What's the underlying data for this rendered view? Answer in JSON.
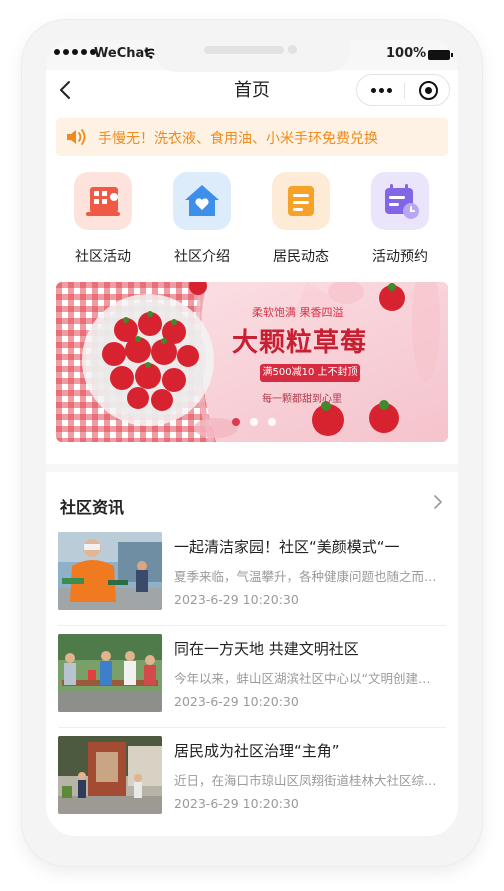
{
  "status_bar": {
    "carrier": "WeChat",
    "battery": "100%"
  },
  "nav": {
    "title": "首页"
  },
  "notice": {
    "text": "手慢无！洗衣液、食用油、小米手环免费兑换"
  },
  "categories": [
    {
      "label": "社区活动",
      "icon": "community-activity-icon",
      "bg": "#fde3dc",
      "color": "#ee5a45"
    },
    {
      "label": "社区介绍",
      "icon": "house-heart-icon",
      "bg": "#dcecfb",
      "color": "#3d8fe8"
    },
    {
      "label": "居民动态",
      "icon": "document-list-icon",
      "bg": "#fdebd6",
      "color": "#f6a127"
    },
    {
      "label": "活动预约",
      "icon": "calendar-clock-icon",
      "bg": "#ebe5fb",
      "color": "#8266e6"
    }
  ],
  "banner": {
    "slogan": "柔软饱满 果香四溢",
    "headline": "大颗粒草莓",
    "promo": "满500减10 上不封顶",
    "subtitle": "每一颗都甜到心里",
    "active_dot": 0,
    "dot_count": 3
  },
  "news": {
    "heading": "社区资讯",
    "items": [
      {
        "title": "一起清洁家园！社区“美颜模式“一",
        "desc": "夏季来临，气温攀升，各种健康问题也随之而…",
        "time": "2023-6-29   10:20:30"
      },
      {
        "title": "同在一方天地 共建文明社区",
        "desc": "今年以来，蚌山区湖滨社区中心以“文明创建…",
        "time": "2023-6-29   10:20:30"
      },
      {
        "title": "居民成为社区治理“主角”",
        "desc": "近日，在海口市琼山区凤翔街道桂林大社区综…",
        "time": "2023-6-29   10:20:30"
      }
    ]
  }
}
